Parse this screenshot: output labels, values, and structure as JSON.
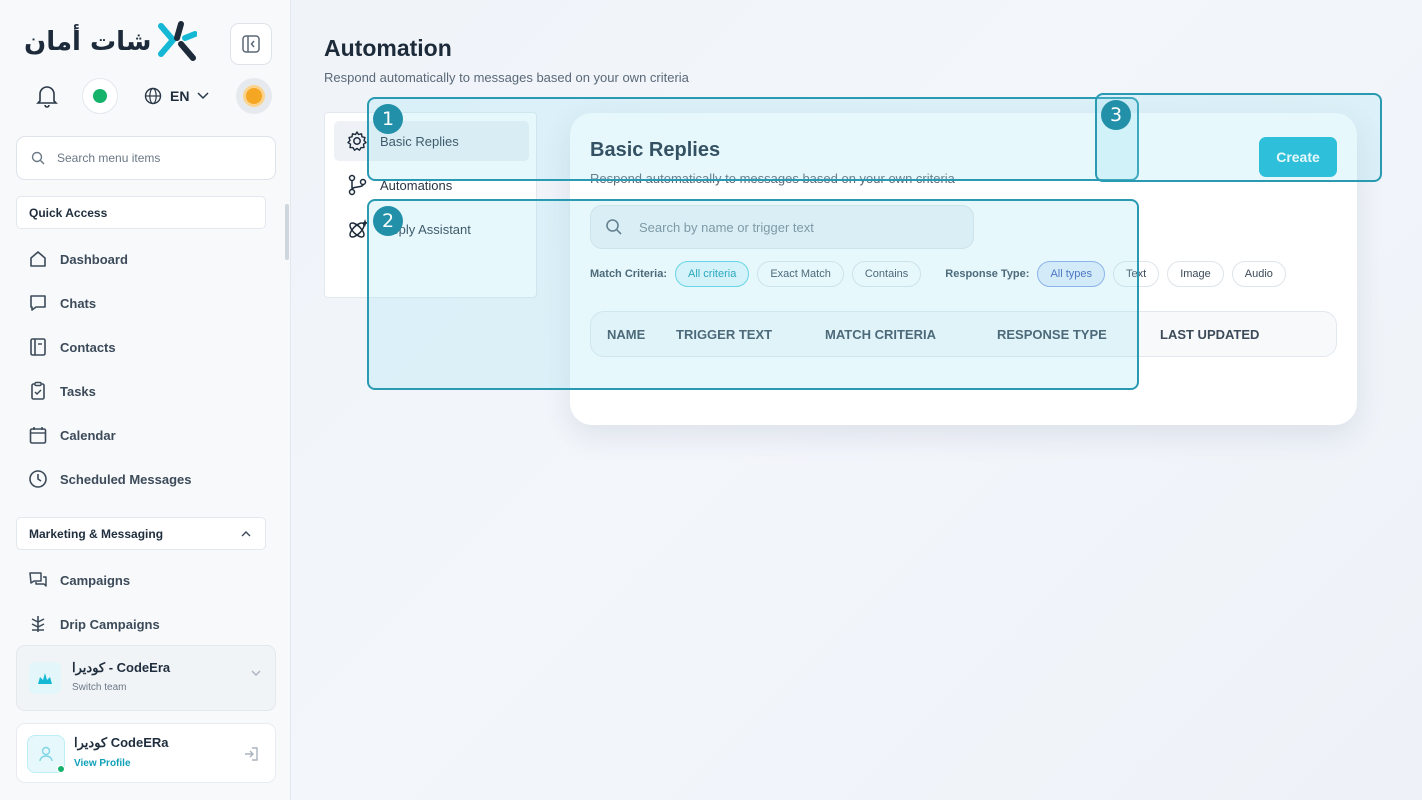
{
  "sidebar": {
    "logo_text": "شات أمان",
    "language": "EN",
    "search_placeholder": "Search menu items",
    "quick_access_label": "Quick Access",
    "quick_access_items": [
      {
        "label": "Dashboard",
        "icon": "home-icon"
      },
      {
        "label": "Chats",
        "icon": "chat-icon"
      },
      {
        "label": "Contacts",
        "icon": "contacts-icon"
      },
      {
        "label": "Tasks",
        "icon": "clipboard-icon"
      },
      {
        "label": "Calendar",
        "icon": "calendar-icon"
      },
      {
        "label": "Scheduled Messages",
        "icon": "clock-icon"
      }
    ],
    "marketing_label": "Marketing & Messaging",
    "marketing_items": [
      {
        "label": "Campaigns",
        "icon": "campaign-icon"
      },
      {
        "label": "Drip Campaigns",
        "icon": "drip-icon"
      }
    ],
    "team": {
      "name": "كوديرا - CodeEra",
      "sub": "Switch team"
    },
    "profile": {
      "name": "كوديرا CodeERa",
      "link": "View Profile"
    }
  },
  "main": {
    "title": "Automation",
    "subtitle": "Respond automatically to messages based on your own criteria",
    "tabs": [
      {
        "label": "Basic Replies",
        "icon": "gear-icon",
        "active": true
      },
      {
        "label": "Automations",
        "icon": "branch-icon",
        "active": false
      },
      {
        "label": "Reply Assistant",
        "icon": "ai-sparkle-icon",
        "active": false
      }
    ],
    "card": {
      "title": "Basic Replies",
      "subtitle": "Respond automatically to messages based on your own criteria",
      "create_label": "Create",
      "search_placeholder": "Search by name or trigger text",
      "match_label": "Match Criteria:",
      "match_options": [
        "All criteria",
        "Exact Match",
        "Contains"
      ],
      "match_selected": "All criteria",
      "response_label": "Response Type:",
      "response_options": [
        "All types",
        "Text",
        "Image",
        "Audio"
      ],
      "response_selected": "All types",
      "columns": [
        "NAME",
        "TRIGGER TEXT",
        "MATCH CRITERIA",
        "RESPONSE TYPE",
        "LAST UPDATED"
      ]
    }
  },
  "overlays": [
    "1",
    "2",
    "3"
  ],
  "colors": {
    "accent": "#14b8d4",
    "overlay": "#2a9ab3",
    "online": "#15b26b"
  }
}
